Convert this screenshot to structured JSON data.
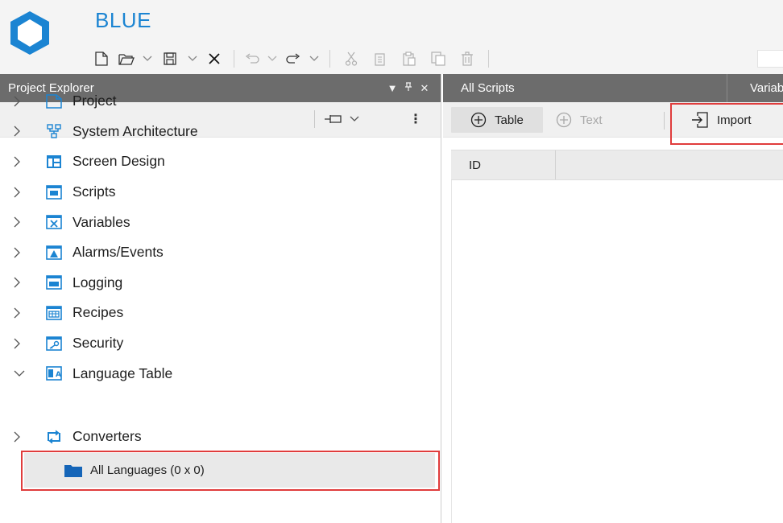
{
  "app": {
    "title": "BLUE",
    "accent_color": "#1b84d2",
    "highlight_color": "#e03c3c"
  },
  "toolbar": {
    "buttons": [
      {
        "icon": "new-file-icon",
        "dropdown": false
      },
      {
        "icon": "open-folder-icon",
        "dropdown": true
      },
      {
        "icon": "save-icon",
        "dropdown": true
      },
      {
        "icon": "close-icon",
        "dropdown": false
      },
      {
        "icon": "undo-icon",
        "dropdown": true,
        "disabled": true
      },
      {
        "icon": "redo-icon",
        "dropdown": true
      },
      {
        "icon": "cut-icon",
        "disabled": true
      },
      {
        "icon": "copy-icon",
        "disabled": true
      },
      {
        "icon": "paste-icon",
        "disabled": true
      },
      {
        "icon": "duplicate-icon",
        "disabled": true
      },
      {
        "icon": "delete-icon",
        "disabled": true
      }
    ]
  },
  "project_explorer": {
    "title": "Project Explorer",
    "header_icons": [
      "dropdown-icon",
      "pin-icon",
      "close-icon"
    ],
    "tree": [
      {
        "label": "Project",
        "icon": "project-icon",
        "expanded": false
      },
      {
        "label": "System Architecture",
        "icon": "system-architecture-icon",
        "expanded": false
      },
      {
        "label": "Screen Design",
        "icon": "screen-design-icon",
        "expanded": false
      },
      {
        "label": "Scripts",
        "icon": "scripts-icon",
        "expanded": false
      },
      {
        "label": "Variables",
        "icon": "variables-icon",
        "expanded": false
      },
      {
        "label": "Alarms/Events",
        "icon": "alarms-icon",
        "expanded": false
      },
      {
        "label": "Logging",
        "icon": "logging-icon",
        "expanded": false
      },
      {
        "label": "Recipes",
        "icon": "recipes-icon",
        "expanded": false
      },
      {
        "label": "Security",
        "icon": "security-icon",
        "expanded": false
      },
      {
        "label": "Language Table",
        "icon": "language-table-icon",
        "expanded": true
      },
      {
        "label": "Converters",
        "icon": "converters-icon",
        "expanded": false
      }
    ],
    "selected_child": {
      "label": "All Languages (0 x 0)",
      "icon": "folder-icon"
    }
  },
  "document": {
    "tabs": [
      {
        "label": "All Scripts",
        "active": true
      },
      {
        "label": "Variab",
        "active": false
      }
    ],
    "commands": {
      "table_label": "Table",
      "text_label": "Text",
      "import_label": "Import"
    },
    "grid": {
      "columns": [
        "ID"
      ]
    }
  }
}
